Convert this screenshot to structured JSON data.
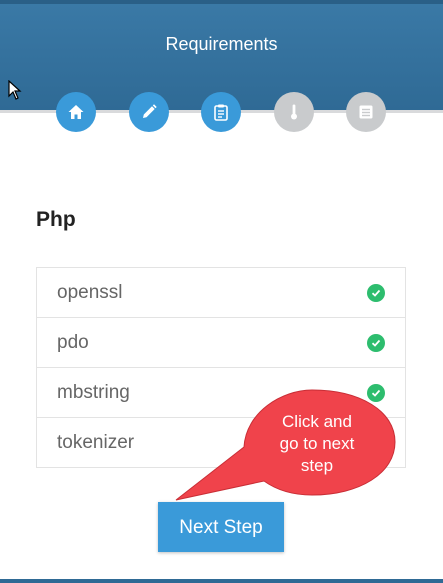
{
  "header": {
    "title": "Requirements"
  },
  "steps": [
    {
      "icon": "home-icon",
      "state": "active"
    },
    {
      "icon": "pencil-icon",
      "state": "active"
    },
    {
      "icon": "clipboard-icon",
      "state": "active"
    },
    {
      "icon": "thermometer-icon",
      "state": "inactive"
    },
    {
      "icon": "list-icon",
      "state": "inactive"
    }
  ],
  "colors": {
    "active_step": "#3a9ad9",
    "inactive_step": "#c9cbcd",
    "check": "#2dbd6e",
    "callout": "#f0434b"
  },
  "section": {
    "title": "Php"
  },
  "requirements": [
    {
      "name": "openssl",
      "status": "check-icon"
    },
    {
      "name": "pdo",
      "status": "check-icon"
    },
    {
      "name": "mbstring",
      "status": "check-icon"
    },
    {
      "name": "tokenizer",
      "status": "check-icon"
    }
  ],
  "actions": {
    "next_label": "Next Step"
  },
  "callout": {
    "line1": "Click and",
    "line2": "go to next",
    "line3": "step"
  }
}
